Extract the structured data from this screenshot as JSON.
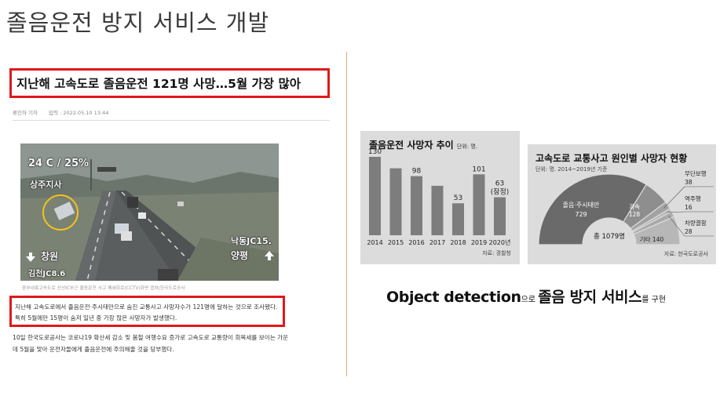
{
  "slide": {
    "title": "졸음운전 방지 서비스 개발",
    "summary": {
      "part1": "Object detection",
      "part2": "으로 ",
      "part3": "졸음 방지 서비스",
      "part4": "를 구현"
    }
  },
  "article": {
    "headline": "지난해 고속도로 졸음운전 121명 사망…5월 가장 많아",
    "author": "류인하 기자",
    "date": "입력 : 2022.05.10 13:44",
    "photo": {
      "overlay_weather": "24 C / 25%",
      "overlay_location": "상주지사",
      "overlay_left_dest": "창원",
      "overlay_left_sub": "김천JC8.6",
      "overlay_right_sub": "낙동JC15.",
      "overlay_right_dest": "양평"
    },
    "caption": "중부내륙고속도로 선산IC부근 졸음운전 사고 폐쇄회로(CCTV)화면 캡쳐|한국도로공사",
    "highlight_paragraph": "지난해 고속도로에서 졸음운전·주시태만으로 숨진 교통사고 사망자수가 121명에 달하는 것으로 조사됐다. 특히 5월에만 15명이 숨져 일년 중 가장 많은 사망자가 발생했다.",
    "paragraph2": "10일 한국도로공사는 코로나19 확산세 감소 및 봄철 여행수요 증가로 고속도로 교통량이 회복세를 보이는 가운데 5월을 맞아 운전자들에게 졸음운전에 주의해줄 것을 당부했다."
  },
  "chart_data": [
    {
      "type": "bar",
      "title": "졸음운전 사망자 추이",
      "unit": "단위: 명.",
      "categories": [
        "2014",
        "2015",
        "2016",
        "2017",
        "2018",
        "2019",
        "2020년"
      ],
      "values": [
        130,
        111,
        98,
        82,
        53,
        101,
        63
      ],
      "data_labels": [
        "130",
        "",
        "98",
        "",
        "53",
        "101",
        "63\n(잠정)"
      ],
      "ylim": [
        0,
        140
      ],
      "color": "#7d7d7d",
      "source": "자료: 경찰청"
    },
    {
      "type": "pie",
      "title": "고속도로 교통사고 원인별 사망자 현황",
      "subtitle": "단위: 명. 2014~2019년 기준",
      "total_label": "총 1079명",
      "slices": [
        {
          "label": "졸음·주시태만",
          "value": 729,
          "color": "#6a6a6a"
        },
        {
          "label": "과속",
          "value": 128,
          "color": "#8e8e8e"
        },
        {
          "label": "무단보행",
          "value": 38,
          "color": "#a2a2a2"
        },
        {
          "label": "역주행",
          "value": 16,
          "color": "#b4b4b4"
        },
        {
          "label": "차량결함",
          "value": 28,
          "color": "#a9a9a9"
        },
        {
          "label": "기타",
          "value": 140,
          "color": "#b7b7b7"
        }
      ],
      "source": "자료: 한국도로공사"
    }
  ]
}
